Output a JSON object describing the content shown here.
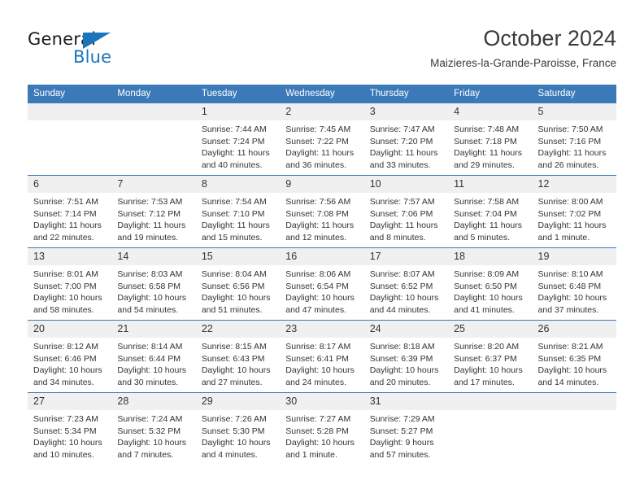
{
  "brand": {
    "name_top": "General",
    "name_bottom": "Blue",
    "accent_color": "#1b75bb",
    "triangle_icon": "triangle-icon"
  },
  "header": {
    "title": "October 2024",
    "subtitle": "Maizieres-la-Grande-Paroisse, France"
  },
  "calendar": {
    "header_bg": "#3b79b9",
    "daynum_bg": "#f0f0f0",
    "weekday_headers": [
      "Sunday",
      "Monday",
      "Tuesday",
      "Wednesday",
      "Thursday",
      "Friday",
      "Saturday"
    ],
    "weeks": [
      [
        {
          "day": "",
          "lines": []
        },
        {
          "day": "",
          "lines": []
        },
        {
          "day": "1",
          "lines": [
            "Sunrise: 7:44 AM",
            "Sunset: 7:24 PM",
            "Daylight: 11 hours",
            "and 40 minutes."
          ]
        },
        {
          "day": "2",
          "lines": [
            "Sunrise: 7:45 AM",
            "Sunset: 7:22 PM",
            "Daylight: 11 hours",
            "and 36 minutes."
          ]
        },
        {
          "day": "3",
          "lines": [
            "Sunrise: 7:47 AM",
            "Sunset: 7:20 PM",
            "Daylight: 11 hours",
            "and 33 minutes."
          ]
        },
        {
          "day": "4",
          "lines": [
            "Sunrise: 7:48 AM",
            "Sunset: 7:18 PM",
            "Daylight: 11 hours",
            "and 29 minutes."
          ]
        },
        {
          "day": "5",
          "lines": [
            "Sunrise: 7:50 AM",
            "Sunset: 7:16 PM",
            "Daylight: 11 hours",
            "and 26 minutes."
          ]
        }
      ],
      [
        {
          "day": "6",
          "lines": [
            "Sunrise: 7:51 AM",
            "Sunset: 7:14 PM",
            "Daylight: 11 hours",
            "and 22 minutes."
          ]
        },
        {
          "day": "7",
          "lines": [
            "Sunrise: 7:53 AM",
            "Sunset: 7:12 PM",
            "Daylight: 11 hours",
            "and 19 minutes."
          ]
        },
        {
          "day": "8",
          "lines": [
            "Sunrise: 7:54 AM",
            "Sunset: 7:10 PM",
            "Daylight: 11 hours",
            "and 15 minutes."
          ]
        },
        {
          "day": "9",
          "lines": [
            "Sunrise: 7:56 AM",
            "Sunset: 7:08 PM",
            "Daylight: 11 hours",
            "and 12 minutes."
          ]
        },
        {
          "day": "10",
          "lines": [
            "Sunrise: 7:57 AM",
            "Sunset: 7:06 PM",
            "Daylight: 11 hours",
            "and 8 minutes."
          ]
        },
        {
          "day": "11",
          "lines": [
            "Sunrise: 7:58 AM",
            "Sunset: 7:04 PM",
            "Daylight: 11 hours",
            "and 5 minutes."
          ]
        },
        {
          "day": "12",
          "lines": [
            "Sunrise: 8:00 AM",
            "Sunset: 7:02 PM",
            "Daylight: 11 hours",
            "and 1 minute."
          ]
        }
      ],
      [
        {
          "day": "13",
          "lines": [
            "Sunrise: 8:01 AM",
            "Sunset: 7:00 PM",
            "Daylight: 10 hours",
            "and 58 minutes."
          ]
        },
        {
          "day": "14",
          "lines": [
            "Sunrise: 8:03 AM",
            "Sunset: 6:58 PM",
            "Daylight: 10 hours",
            "and 54 minutes."
          ]
        },
        {
          "day": "15",
          "lines": [
            "Sunrise: 8:04 AM",
            "Sunset: 6:56 PM",
            "Daylight: 10 hours",
            "and 51 minutes."
          ]
        },
        {
          "day": "16",
          "lines": [
            "Sunrise: 8:06 AM",
            "Sunset: 6:54 PM",
            "Daylight: 10 hours",
            "and 47 minutes."
          ]
        },
        {
          "day": "17",
          "lines": [
            "Sunrise: 8:07 AM",
            "Sunset: 6:52 PM",
            "Daylight: 10 hours",
            "and 44 minutes."
          ]
        },
        {
          "day": "18",
          "lines": [
            "Sunrise: 8:09 AM",
            "Sunset: 6:50 PM",
            "Daylight: 10 hours",
            "and 41 minutes."
          ]
        },
        {
          "day": "19",
          "lines": [
            "Sunrise: 8:10 AM",
            "Sunset: 6:48 PM",
            "Daylight: 10 hours",
            "and 37 minutes."
          ]
        }
      ],
      [
        {
          "day": "20",
          "lines": [
            "Sunrise: 8:12 AM",
            "Sunset: 6:46 PM",
            "Daylight: 10 hours",
            "and 34 minutes."
          ]
        },
        {
          "day": "21",
          "lines": [
            "Sunrise: 8:14 AM",
            "Sunset: 6:44 PM",
            "Daylight: 10 hours",
            "and 30 minutes."
          ]
        },
        {
          "day": "22",
          "lines": [
            "Sunrise: 8:15 AM",
            "Sunset: 6:43 PM",
            "Daylight: 10 hours",
            "and 27 minutes."
          ]
        },
        {
          "day": "23",
          "lines": [
            "Sunrise: 8:17 AM",
            "Sunset: 6:41 PM",
            "Daylight: 10 hours",
            "and 24 minutes."
          ]
        },
        {
          "day": "24",
          "lines": [
            "Sunrise: 8:18 AM",
            "Sunset: 6:39 PM",
            "Daylight: 10 hours",
            "and 20 minutes."
          ]
        },
        {
          "day": "25",
          "lines": [
            "Sunrise: 8:20 AM",
            "Sunset: 6:37 PM",
            "Daylight: 10 hours",
            "and 17 minutes."
          ]
        },
        {
          "day": "26",
          "lines": [
            "Sunrise: 8:21 AM",
            "Sunset: 6:35 PM",
            "Daylight: 10 hours",
            "and 14 minutes."
          ]
        }
      ],
      [
        {
          "day": "27",
          "lines": [
            "Sunrise: 7:23 AM",
            "Sunset: 5:34 PM",
            "Daylight: 10 hours",
            "and 10 minutes."
          ]
        },
        {
          "day": "28",
          "lines": [
            "Sunrise: 7:24 AM",
            "Sunset: 5:32 PM",
            "Daylight: 10 hours",
            "and 7 minutes."
          ]
        },
        {
          "day": "29",
          "lines": [
            "Sunrise: 7:26 AM",
            "Sunset: 5:30 PM",
            "Daylight: 10 hours",
            "and 4 minutes."
          ]
        },
        {
          "day": "30",
          "lines": [
            "Sunrise: 7:27 AM",
            "Sunset: 5:28 PM",
            "Daylight: 10 hours",
            "and 1 minute."
          ]
        },
        {
          "day": "31",
          "lines": [
            "Sunrise: 7:29 AM",
            "Sunset: 5:27 PM",
            "Daylight: 9 hours",
            "and 57 minutes."
          ]
        },
        {
          "day": "",
          "lines": []
        },
        {
          "day": "",
          "lines": []
        }
      ]
    ]
  }
}
